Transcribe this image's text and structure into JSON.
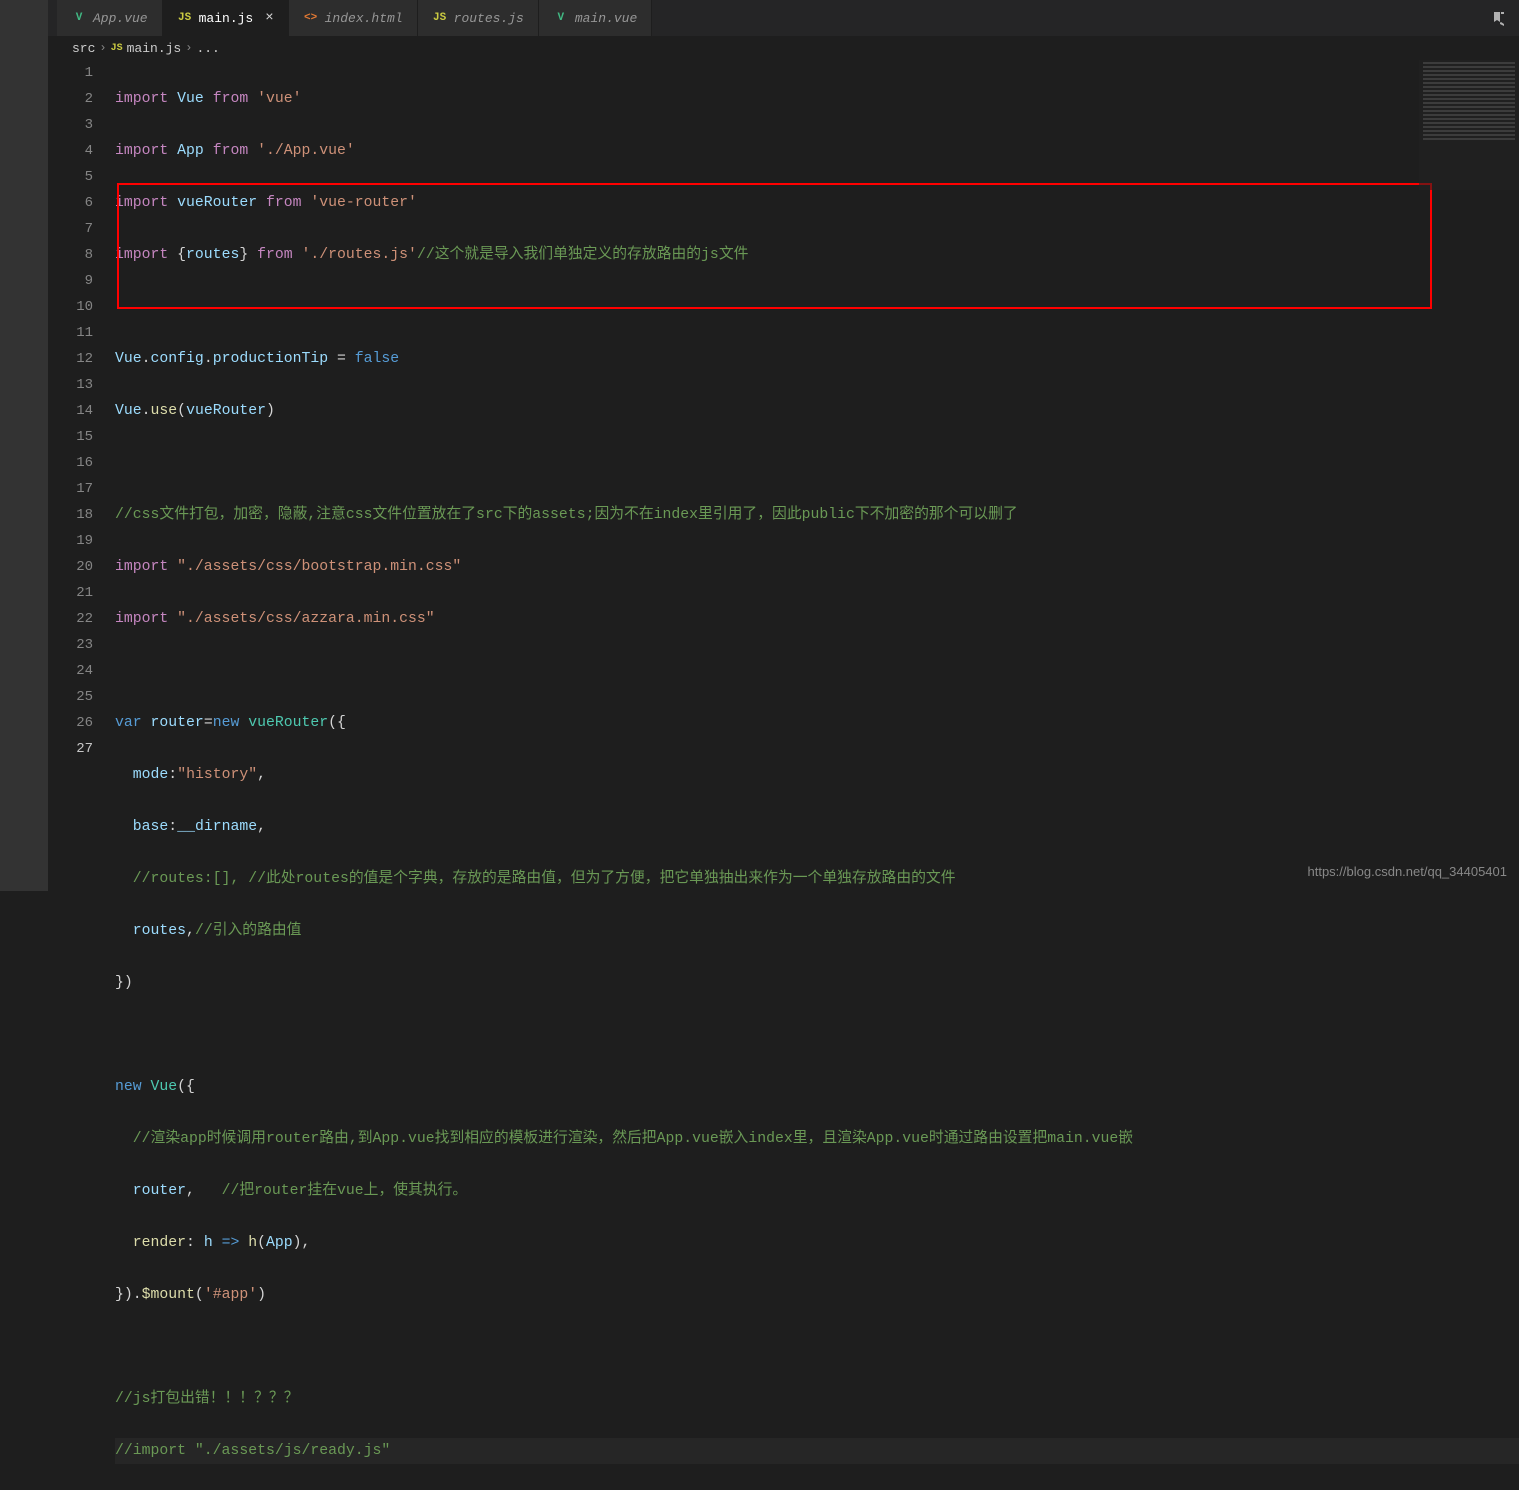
{
  "tabs": [
    {
      "icon": "vue",
      "label": "App.vue"
    },
    {
      "icon": "js",
      "label": "main.js",
      "active": true
    },
    {
      "icon": "html",
      "label": "index.html"
    },
    {
      "icon": "js",
      "label": "routes.js"
    },
    {
      "icon": "vue",
      "label": "main.vue"
    }
  ],
  "breadcrumbs": {
    "p1": "src",
    "p2": "main.js",
    "p3": "..."
  },
  "icons": {
    "js": "JS",
    "vue": "V",
    "html": "<>"
  },
  "lines": [
    "1",
    "2",
    "3",
    "4",
    "5",
    "6",
    "7",
    "8",
    "9",
    "10",
    "11",
    "12",
    "13",
    "14",
    "15",
    "16",
    "17",
    "18",
    "19",
    "20",
    "21",
    "22",
    "23",
    "24",
    "25",
    "26",
    "27"
  ],
  "code": {
    "l1": {
      "a": "import",
      "b": " Vue ",
      "c": "from",
      "d": " 'vue'"
    },
    "l2": {
      "a": "import",
      "b": " App ",
      "c": "from",
      "d": " './App.vue'"
    },
    "l3": {
      "a": "import",
      "b": " vueRouter ",
      "c": "from",
      "d": " 'vue-router'"
    },
    "l4": {
      "a": "import",
      "b": " {",
      "c": "routes",
      "d": "} ",
      "e": "from",
      "f": " './routes.js'",
      "g": "//这个就是导入我们单独定义的存放路由的js文件"
    },
    "l6": {
      "a": "Vue",
      "b": ".",
      "c": "config",
      "d": ".",
      "e": "productionTip",
      "f": " = ",
      "g": "false"
    },
    "l7": {
      "a": "Vue",
      "b": ".",
      "c": "use",
      "d": "(",
      "e": "vueRouter",
      "f": ")"
    },
    "l9": {
      "a": "//css文件打包，加密，隐蔽,注意css文件位置放在了src下的assets;因为不在index里引用了，因此public下不加密的那个可以删了"
    },
    "l10": {
      "a": "import",
      "b": " \"./assets/css/bootstrap.min.css\""
    },
    "l11": {
      "a": "import",
      "b": " \"./assets/css/azzara.min.css\""
    },
    "l13": {
      "a": "var",
      "b": " ",
      "c": "router",
      "d": "=",
      "e": "new",
      "f": " ",
      "g": "vueRouter",
      "h": "({"
    },
    "l14": {
      "a": "mode",
      "b": ":",
      "c": "\"history\"",
      "d": ","
    },
    "l15": {
      "a": "base",
      "b": ":",
      "c": "__dirname",
      "d": ","
    },
    "l16": {
      "a": "//routes:[], //此处routes的值是个字典，存放的是路由值，但为了方便，把它单独抽出来作为一个单独存放路由的文件"
    },
    "l17": {
      "a": "routes",
      "b": ",",
      "c": "//引入的路由值"
    },
    "l18": {
      "a": "})"
    },
    "l20": {
      "a": "new",
      "b": " ",
      "c": "Vue",
      "d": "({"
    },
    "l21": {
      "a": "//渲染app时候调用router路由,到App.vue找到相应的模板进行渲染，然后把App.vue嵌入index里，且渲染App.vue时通过路由设置把main.vue嵌"
    },
    "l22": {
      "a": "router",
      "b": ",   ",
      "c": "//把router挂在vue上，使其执行。"
    },
    "l23": {
      "a": "render",
      "b": ":",
      "c": " h ",
      "d": "=>",
      "e": " ",
      "f": "h",
      "g": "(",
      "h": "App",
      "i": "),"
    },
    "l24": {
      "a": "}).",
      "b": "$mount",
      "c": "(",
      "d": "'#app'",
      "e": ")"
    },
    "l26": {
      "a": "//js打包出错！！！？？？"
    },
    "l27": {
      "a": "//import \"./assets/js/ready.js\""
    }
  },
  "watermark": "https://blog.csdn.net/qq_34405401"
}
